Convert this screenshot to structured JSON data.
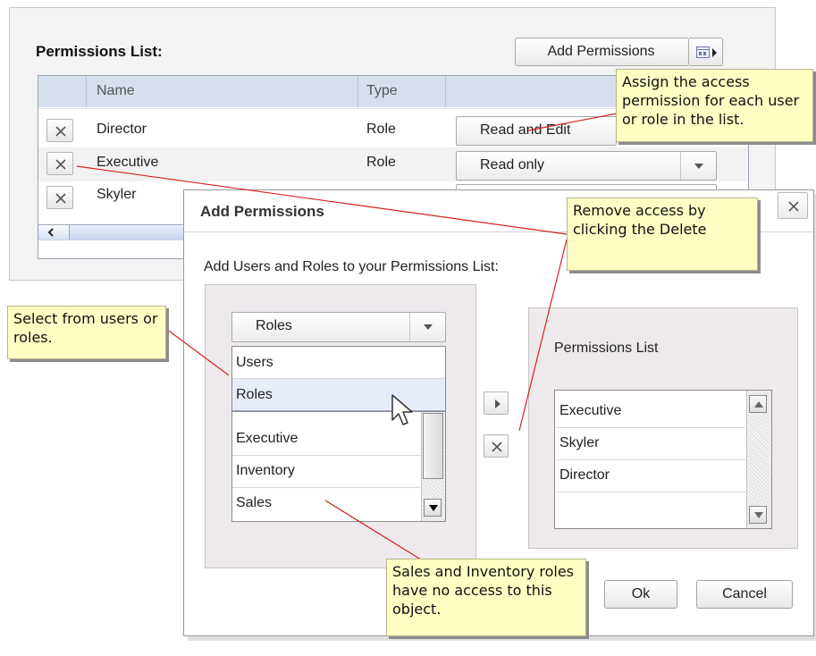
{
  "permissions_panel": {
    "title": "Permissions List:",
    "add_button_label": "Add Permissions",
    "columns": [
      "Name",
      "Type"
    ],
    "rows": [
      {
        "name": "Director",
        "type": "Role",
        "access": "Read and Edit"
      },
      {
        "name": "Executive",
        "type": "Role",
        "access": "Read only"
      },
      {
        "name": "Skyler",
        "type": "",
        "access": ""
      }
    ]
  },
  "dialog": {
    "title": "Add Permissions",
    "instruction": "Add Users and Roles to your Permissions List:",
    "type_select": {
      "selected": "Roles",
      "options": [
        "Users",
        "Roles"
      ]
    },
    "available_list": [
      "Executive",
      "Inventory",
      "Sales"
    ],
    "permissions_list_label": "Permissions List",
    "permissions_list": [
      "Executive",
      "Skyler",
      "Director"
    ],
    "ok_label": "Ok",
    "cancel_label": "Cancel"
  },
  "callouts": {
    "assign": "Assign the access permission for each user or role in the list.",
    "remove": "Remove access by clicking the Delete",
    "select": "Select from users or roles.",
    "sales": "Sales and Inventory roles have no access to this object."
  },
  "icons": {
    "delete": "close-icon",
    "dropdown": "chevron-down-icon",
    "add_arrow": "arrow-right-icon",
    "split_menu": "columns-icon",
    "cursor": "mouse-pointer-icon"
  },
  "colors": {
    "callout_bg": "#ffffc4",
    "leader_line": "#d62020",
    "table_header": "#d7dfec",
    "pane_bg": "#ede9ed",
    "highlight_item": "#e7edf8"
  }
}
